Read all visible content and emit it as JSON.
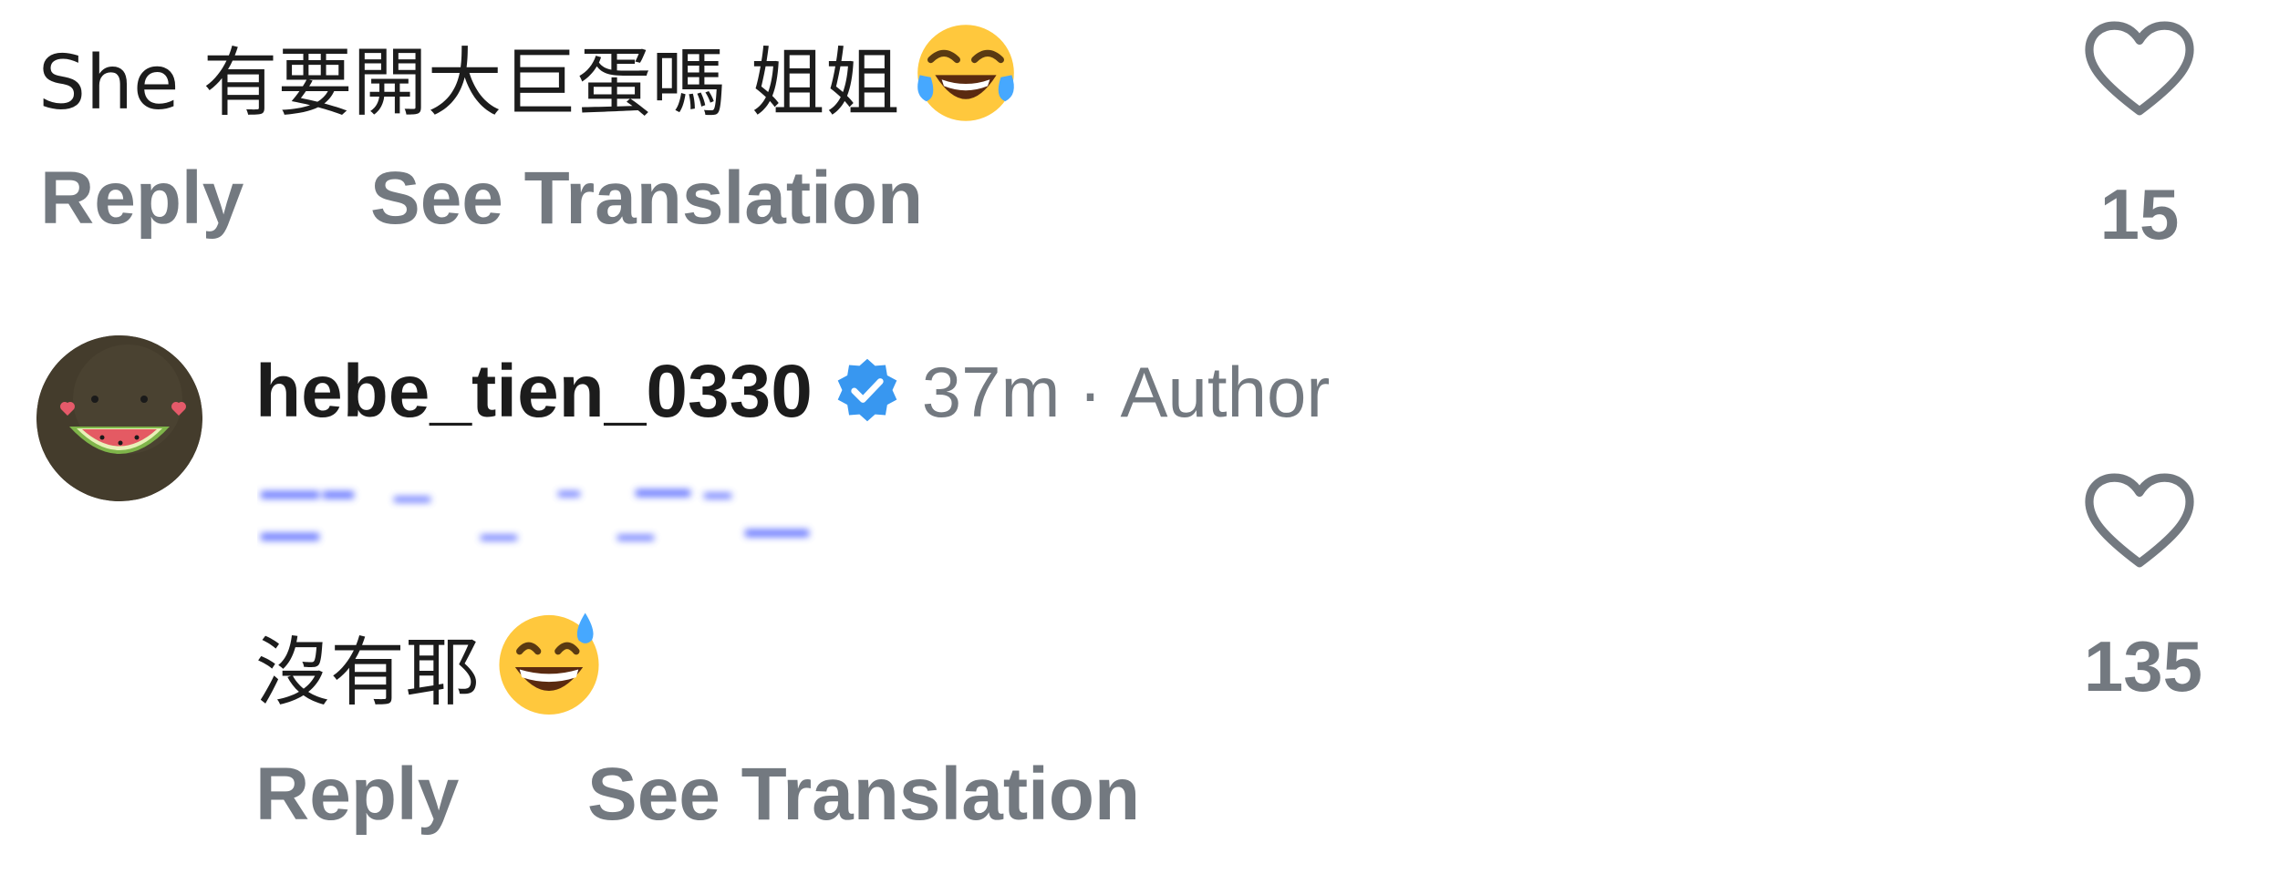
{
  "comment_1": {
    "text": "She 有要開大巨蛋嗎 姐姐",
    "emoji": "laughing-with-tears-emoji",
    "reply_label": "Reply",
    "translate_label": "See Translation",
    "like_count": "15"
  },
  "comment_2": {
    "username": "hebe_tien_0330",
    "verified_icon": "verified-badge-icon",
    "time": "37m",
    "separator": "·",
    "role": "Author",
    "mention_blurred": true,
    "text": "沒有耶",
    "emoji": "grinning-sweat-emoji",
    "reply_label": "Reply",
    "translate_label": "See Translation",
    "like_count": "135"
  },
  "colors": {
    "primary_text": "#1c1c1c",
    "secondary_text": "#737980",
    "verified_blue": "#3897f0",
    "mention_blue": "#4a5cff",
    "heart_stroke": "#737980"
  }
}
